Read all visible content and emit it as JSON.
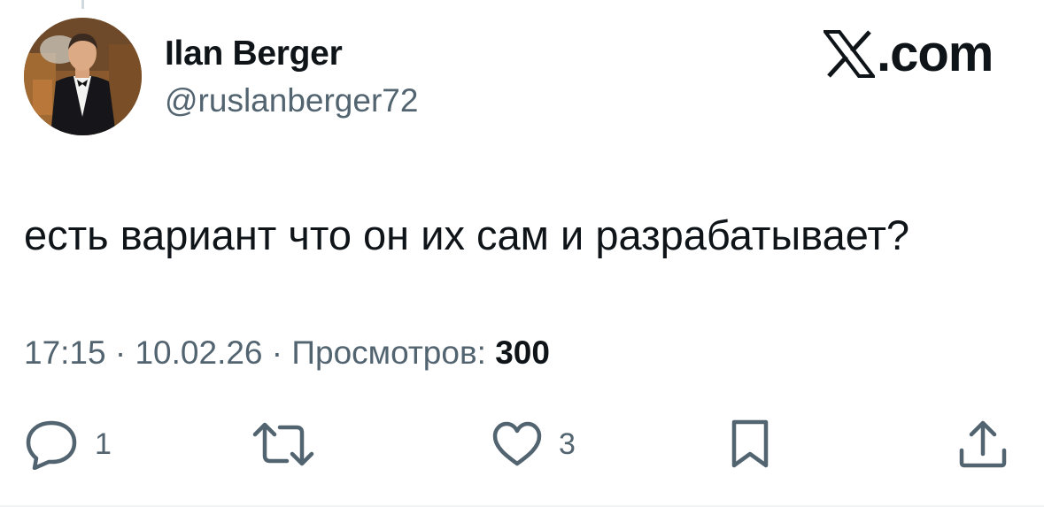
{
  "author": {
    "display_name": "Ilan Berger",
    "handle": "@ruslanberger72",
    "avatar_icon": "profile-photo-man-in-tuxedo"
  },
  "brand": {
    "text": ".com",
    "icon": "x-logo-icon"
  },
  "tweet": {
    "text": "есть вариант что он их сам и разрабатывает?"
  },
  "meta": {
    "time": "17:15",
    "separator": " · ",
    "date": "10.02.26",
    "views_label": "Просмотров: ",
    "views_count": "300"
  },
  "actions": {
    "reply": {
      "icon": "reply-bubble-icon",
      "count": "1"
    },
    "retweet": {
      "icon": "retweet-icon",
      "count": ""
    },
    "like": {
      "icon": "heart-icon",
      "count": "3"
    },
    "bookmark": {
      "icon": "bookmark-icon",
      "count": ""
    },
    "share": {
      "icon": "share-icon",
      "count": ""
    }
  },
  "colors": {
    "text": "#0f1419",
    "secondary": "#536471",
    "background": "#ffffff"
  }
}
